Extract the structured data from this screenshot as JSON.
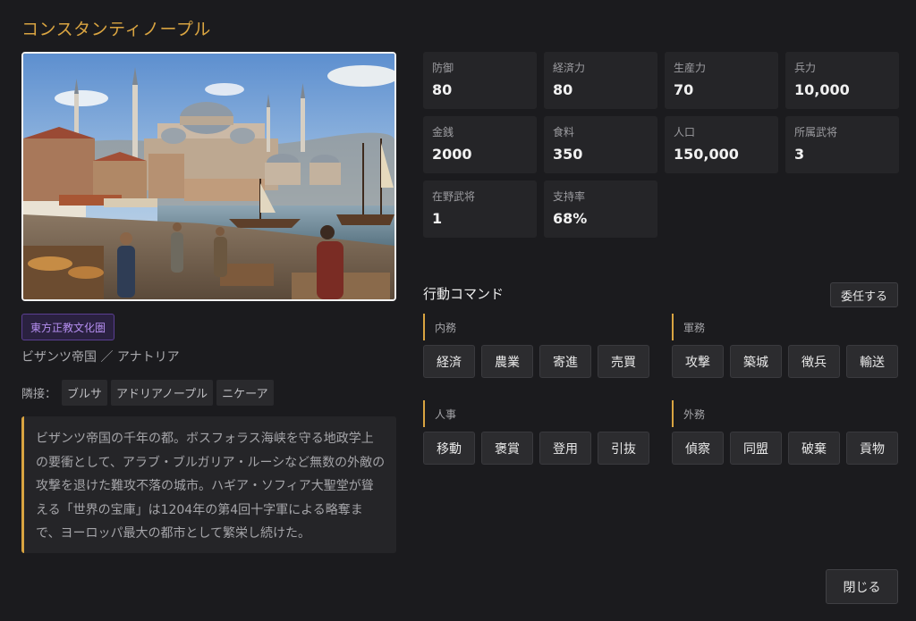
{
  "city_name": "コンスタンティノープル",
  "culture": "東方正教文化圏",
  "region": "ビザンツ帝国 ／ アナトリア",
  "adjacent": {
    "label": "隣接：",
    "cities": [
      "ブルサ",
      "アドリアノープル",
      "ニケーア"
    ]
  },
  "description": "ビザンツ帝国の千年の都。ボスフォラス海峡を守る地政学上の要衝として、アラブ・ブルガリア・ルーシなど無数の外敵の攻撃を退けた難攻不落の城市。ハギア・ソフィア大聖堂が聳える「世界の宝庫」は1204年の第4回十字軍による略奪まで、ヨーロッパ最大の都市として繁栄し続けた。",
  "stats": [
    {
      "label": "防御",
      "value": "80"
    },
    {
      "label": "経済力",
      "value": "80"
    },
    {
      "label": "生産力",
      "value": "70"
    },
    {
      "label": "兵力",
      "value": "10,000"
    },
    {
      "label": "金銭",
      "value": "2000"
    },
    {
      "label": "食料",
      "value": "350"
    },
    {
      "label": "人口",
      "value": "150,000"
    },
    {
      "label": "所属武将",
      "value": "3"
    },
    {
      "label": "在野武将",
      "value": "1"
    },
    {
      "label": "支持率",
      "value": "68%"
    }
  ],
  "commands": {
    "title": "行動コマンド",
    "delegate_label": "委任する",
    "groups": [
      {
        "label": "内務",
        "buttons": [
          "経済",
          "農業",
          "寄進",
          "売買"
        ]
      },
      {
        "label": "軍務",
        "buttons": [
          "攻撃",
          "築城",
          "徴兵",
          "輸送"
        ]
      },
      {
        "label": "人事",
        "buttons": [
          "移動",
          "褒賞",
          "登用",
          "引抜"
        ]
      },
      {
        "label": "外務",
        "buttons": [
          "偵察",
          "同盟",
          "破棄",
          "貢物"
        ]
      }
    ]
  },
  "close_label": "閉じる",
  "colors": {
    "background": "#1b1b1e",
    "panel": "#252528",
    "accent_gold": "#d9a441",
    "culture_purple": "#b58ef0"
  }
}
